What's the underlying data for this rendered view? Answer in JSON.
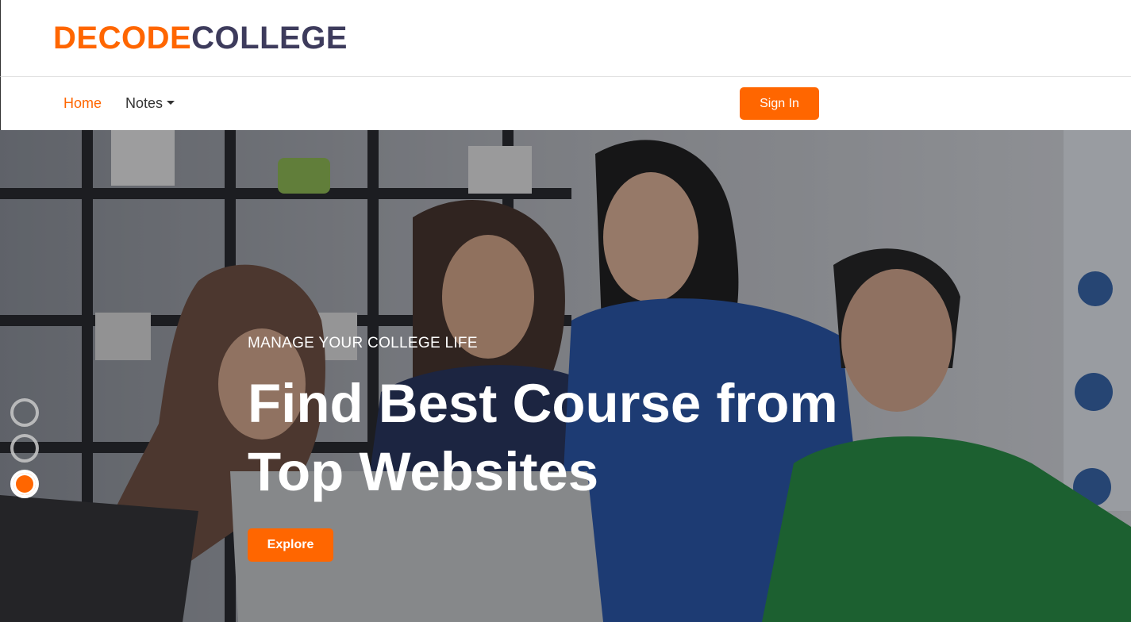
{
  "brand": {
    "part1": "DECODE",
    "part2": "COLLEGE",
    "color1": "#ff6600",
    "color2": "#3d3b5c"
  },
  "nav": {
    "items": [
      {
        "label": "Home",
        "active": true
      },
      {
        "label": "Notes",
        "dropdown": true
      }
    ],
    "signin_label": "Sign In"
  },
  "hero": {
    "kicker": "MANAGE YOUR COLLEGE LIFE",
    "headline_line1": "Find Best Course from",
    "headline_line2": "Top Websites",
    "button_label": "Explore",
    "slides": {
      "count": 3,
      "active_index": 2
    }
  },
  "colors": {
    "accent": "#ff6600",
    "text_dark": "#333333"
  },
  "icons": [
    "chevron-down-icon"
  ]
}
